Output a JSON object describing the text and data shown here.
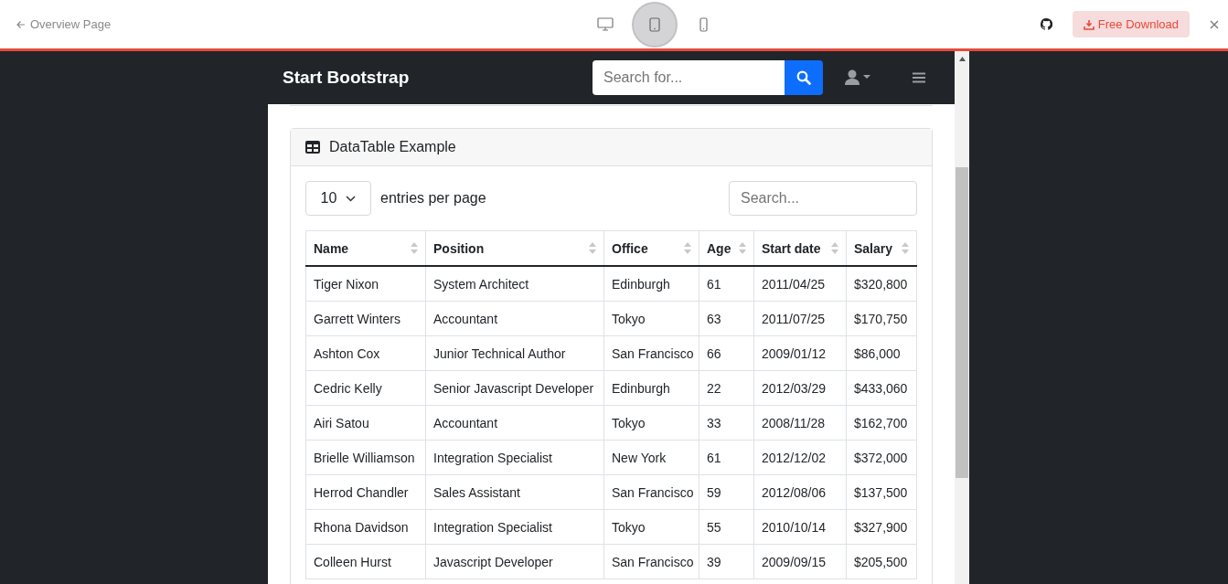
{
  "preview_bar": {
    "back_link": "Overview Page",
    "devices": [
      {
        "kind": "desktop",
        "selected": false
      },
      {
        "kind": "tablet",
        "selected": true
      },
      {
        "kind": "phone",
        "selected": false
      }
    ],
    "download_button": "Free Download"
  },
  "navbar": {
    "brand": "Start Bootstrap",
    "search": {
      "placeholder": "Search for..."
    }
  },
  "card": {
    "title": "DataTable Example",
    "page_size": "10",
    "page_size_label": "entries per page",
    "search": {
      "placeholder": "Search..."
    },
    "table": {
      "columns": [
        "Name",
        "Position",
        "Office",
        "Age",
        "Start date",
        "Salary"
      ],
      "rows": [
        [
          "Tiger Nixon",
          "System Architect",
          "Edinburgh",
          "61",
          "2011/04/25",
          "$320,800"
        ],
        [
          "Garrett Winters",
          "Accountant",
          "Tokyo",
          "63",
          "2011/07/25",
          "$170,750"
        ],
        [
          "Ashton Cox",
          "Junior Technical Author",
          "San Francisco",
          "66",
          "2009/01/12",
          "$86,000"
        ],
        [
          "Cedric Kelly",
          "Senior Javascript Developer",
          "Edinburgh",
          "22",
          "2012/03/29",
          "$433,060"
        ],
        [
          "Airi Satou",
          "Accountant",
          "Tokyo",
          "33",
          "2008/11/28",
          "$162,700"
        ],
        [
          "Brielle Williamson",
          "Integration Specialist",
          "New York",
          "61",
          "2012/12/02",
          "$372,000"
        ],
        [
          "Herrod Chandler",
          "Sales Assistant",
          "San Francisco",
          "59",
          "2012/08/06",
          "$137,500"
        ],
        [
          "Rhona Davidson",
          "Integration Specialist",
          "Tokyo",
          "55",
          "2010/10/14",
          "$327,900"
        ],
        [
          "Colleen Hurst",
          "Javascript Developer",
          "San Francisco",
          "39",
          "2009/09/15",
          "$205,500"
        ]
      ]
    }
  }
}
